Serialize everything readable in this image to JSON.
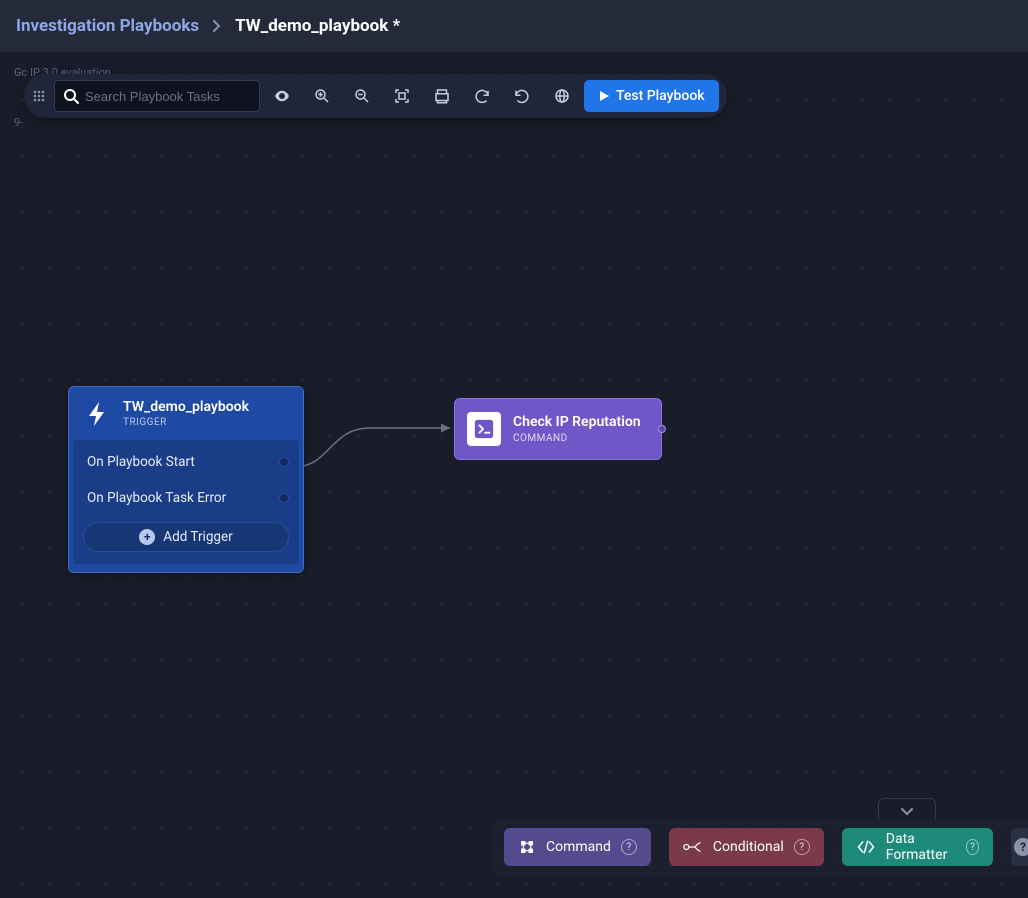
{
  "breadcrumb": {
    "root": "Investigation Playbooks",
    "leaf": "TW_demo_playbook *"
  },
  "ghost": {
    "line1": "Gc IP 3.0 evaluation",
    "line2": "9-"
  },
  "toolbar": {
    "search_placeholder": "Search Playbook Tasks",
    "test_label": "Test Playbook"
  },
  "trigger_node": {
    "title": "TW_demo_playbook",
    "subtitle": "TRIGGER",
    "rows": [
      "On Playbook Start",
      "On Playbook Task Error"
    ],
    "add_label": "Add Trigger"
  },
  "command_node": {
    "title": "Check IP Reputation",
    "subtitle": "COMMAND"
  },
  "palette": {
    "command": "Command",
    "conditional": "Conditional",
    "formatter": "Data Formatter"
  }
}
